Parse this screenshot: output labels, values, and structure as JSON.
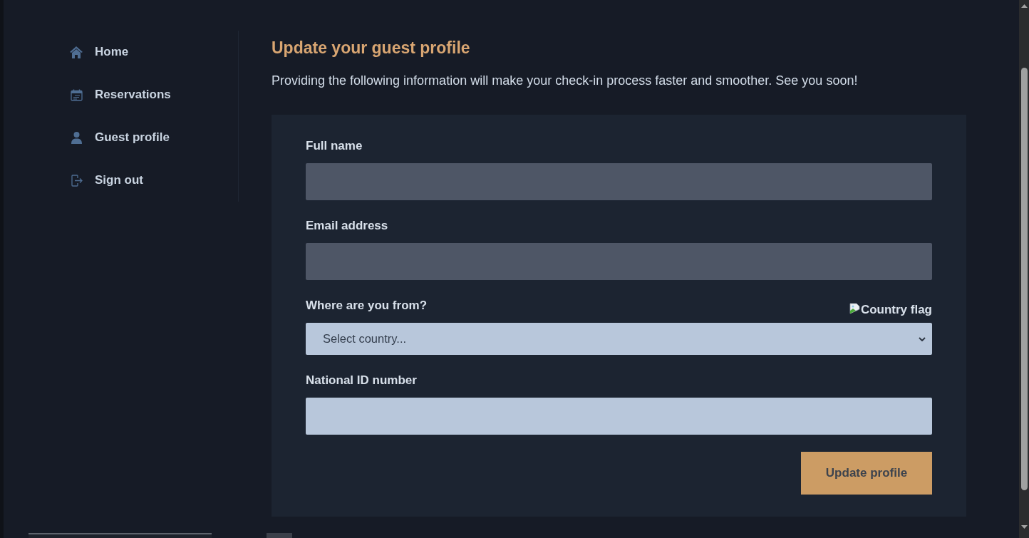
{
  "sidebar": {
    "items": [
      {
        "label": "Home"
      },
      {
        "label": "Reservations"
      },
      {
        "label": "Guest profile"
      },
      {
        "label": "Sign out"
      }
    ]
  },
  "main": {
    "title": "Update your guest profile",
    "intro": "Providing the following information will make your check-in process faster and smoother. See you soon!"
  },
  "form": {
    "fields": [
      {
        "kind": "text",
        "label": "Full name",
        "disabled": true
      },
      {
        "kind": "text",
        "label": "Email address",
        "disabled": true
      },
      {
        "kind": "select",
        "label": "Where are you from?",
        "image_alt": "Country flag",
        "placeholder": "Select country..."
      },
      {
        "kind": "text",
        "label": "National ID number",
        "disabled": false
      }
    ],
    "submit_button": "Update profile"
  }
}
